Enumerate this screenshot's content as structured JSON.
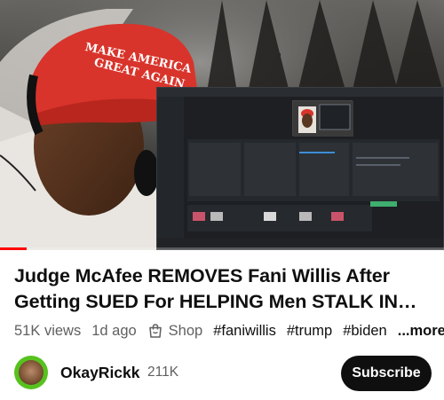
{
  "video": {
    "hat_text": "MAKE AMERICA GREAT AGAIN",
    "progress_fraction": 0.06
  },
  "title": {
    "line1": "Judge McAfee REMOVES Fani Willis After",
    "line2": "Getting SUED For HELPING Men STALK IN…"
  },
  "meta": {
    "views": "51K views",
    "age": "1d ago",
    "shop_label": "Shop",
    "shop_icon": "shopping-bag-icon",
    "tags": [
      "#faniwillis",
      "#trump",
      "#biden"
    ],
    "more_label": "...more"
  },
  "channel": {
    "name": "OkayRickk",
    "subscribers": "211K",
    "avatar_color": "#56c21e",
    "subscribe_label": "Subscribe"
  }
}
